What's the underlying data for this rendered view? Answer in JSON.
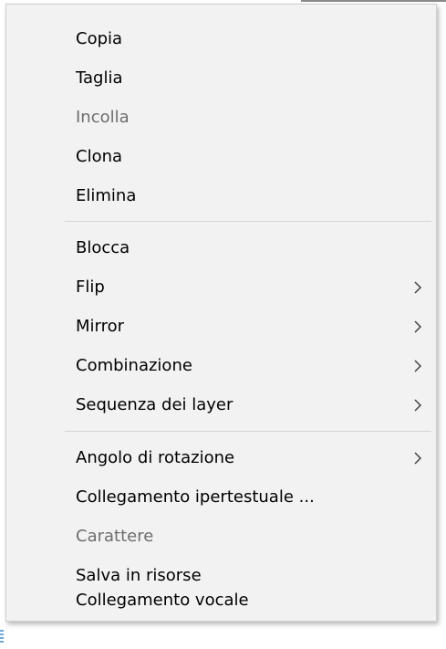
{
  "menu": {
    "items": [
      {
        "label": "Copia",
        "enabled": true,
        "submenu": false
      },
      {
        "label": "Taglia",
        "enabled": true,
        "submenu": false
      },
      {
        "label": "Incolla",
        "enabled": false,
        "submenu": false
      },
      {
        "label": "Clona",
        "enabled": true,
        "submenu": false
      },
      {
        "label": "Elimina",
        "enabled": true,
        "submenu": false
      },
      {
        "label": "Blocca",
        "enabled": true,
        "submenu": false
      },
      {
        "label": "Flip",
        "enabled": true,
        "submenu": true
      },
      {
        "label": "Mirror",
        "enabled": true,
        "submenu": true
      },
      {
        "label": "Combinazione",
        "enabled": true,
        "submenu": true
      },
      {
        "label": "Sequenza dei layer",
        "enabled": true,
        "submenu": true
      },
      {
        "label": "Angolo di rotazione",
        "enabled": true,
        "submenu": true
      },
      {
        "label": "Collegamento ipertestuale ...",
        "enabled": true,
        "submenu": false
      },
      {
        "label": "Carattere",
        "enabled": false,
        "submenu": false
      },
      {
        "label": "Salva in risorse",
        "enabled": true,
        "submenu": false
      },
      {
        "label": "Collegamento vocale",
        "enabled": true,
        "submenu": false
      }
    ],
    "submenu_icon": "chevron-right-icon"
  },
  "colors": {
    "menu_background": "#f2f2f2",
    "enabled_text": "#000000",
    "disabled_text": "#6d6d6d",
    "separator": "#d4d4d4"
  }
}
